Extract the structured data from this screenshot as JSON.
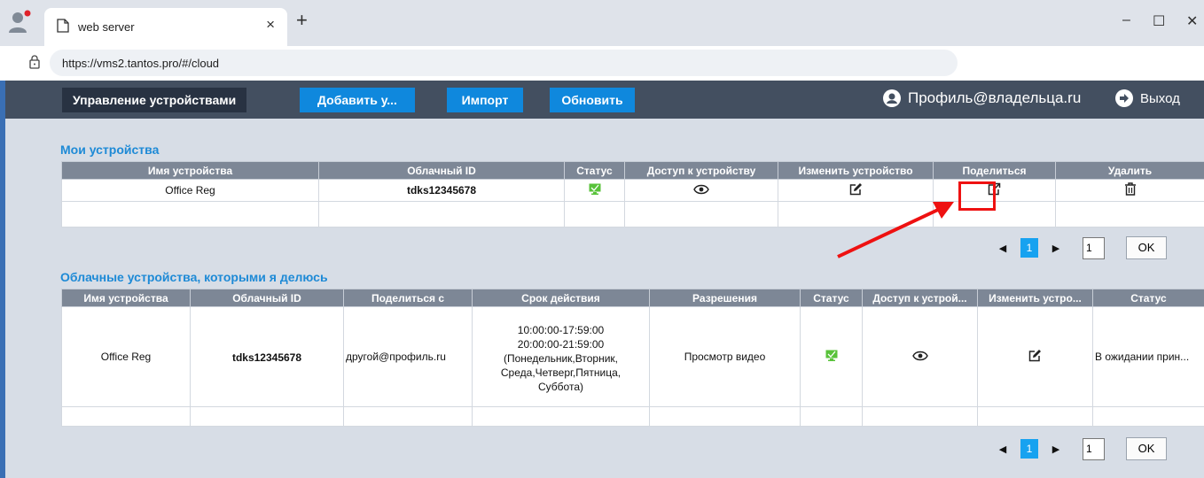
{
  "browser": {
    "tab_title": "web server",
    "tab_close": "×",
    "new_tab": "+",
    "url": "https://vms2.tantos.pro/#/cloud",
    "window_controls": {
      "minimize": "–",
      "maximize": "☐",
      "close": "✕"
    }
  },
  "appbar": {
    "title": "Управление устройствами",
    "add_button": "Добавить у...",
    "import_button": "Импорт",
    "refresh_button": "Обновить",
    "profile": "Профиль@владельца.ru",
    "logout": "Выход"
  },
  "my_devices": {
    "title": "Мои устройства",
    "headers": [
      "Имя устройства",
      "Облачный ID",
      "Статус",
      "Доступ к устройству",
      "Изменить устройство",
      "Поделиться",
      "Удалить"
    ],
    "rows": [
      {
        "name": "Office Reg",
        "cloud_id": "tdks12345678"
      }
    ],
    "pager": {
      "prev": "◀",
      "page": "1",
      "next": "▶",
      "page_input": "1",
      "ok": "OK"
    }
  },
  "shared_devices": {
    "title": "Облачные устройства, которыми я делюсь",
    "headers": [
      "Имя устройства",
      "Облачный ID",
      "Поделиться с",
      "Срок действия",
      "Разрешения",
      "Статус",
      "Доступ к устрой...",
      "Изменить устро...",
      "Статус"
    ],
    "rows": [
      {
        "name": "Office Reg",
        "cloud_id": "tdks12345678",
        "share_with": "другой@профиль.ru",
        "validity": "10:00:00-17:59:00\n20:00:00-21:59:00\n(Понедельник,Вторник,\nСреда,Четверг,Пятница,\nСуббота)",
        "permissions": "Просмотр видео",
        "share_status": "В ожидании прин..."
      }
    ],
    "pager": {
      "prev": "◀",
      "page": "1",
      "next": "▶",
      "page_input": "1",
      "ok": "OK"
    }
  },
  "colors": {
    "appbar": "#434f60",
    "accent_blue": "#0f88dd",
    "section_title": "#1e8ad6",
    "table_header": "#7d8796",
    "highlight": "#ee1111",
    "status_online": "#58c23a"
  },
  "icons": [
    "user-avatar-icon",
    "page-icon",
    "lock-icon",
    "person-icon",
    "logout-arrow-icon",
    "monitor-status-icon",
    "eye-icon",
    "edit-icon",
    "share-icon",
    "trash-icon"
  ]
}
